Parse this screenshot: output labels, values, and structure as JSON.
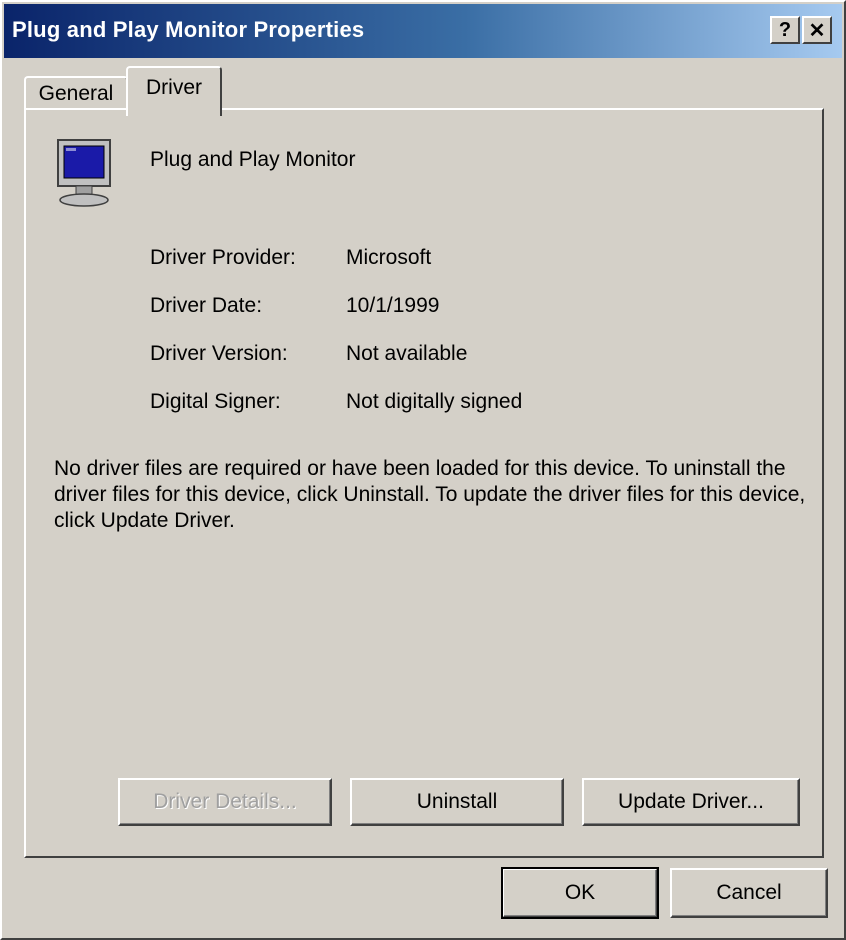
{
  "window": {
    "title": "Plug and Play Monitor Properties"
  },
  "titlebar_buttons": {
    "help_label": "?",
    "close_label": "✕"
  },
  "tabs": [
    {
      "label": "General",
      "active": false
    },
    {
      "label": "Driver",
      "active": true
    }
  ],
  "device": {
    "name": "Plug and Play Monitor",
    "icon": "monitor-icon"
  },
  "properties": [
    {
      "label": "Driver Provider:",
      "value": "Microsoft"
    },
    {
      "label": "Driver Date:",
      "value": "10/1/1999"
    },
    {
      "label": "Driver Version:",
      "value": "Not available"
    },
    {
      "label": "Digital Signer:",
      "value": "Not digitally signed"
    }
  ],
  "description": "No driver files are required or have been loaded for this device. To uninstall the driver files for this device, click Uninstall. To update the driver files for this device, click Update Driver.",
  "actions": {
    "driver_details": "Driver Details...",
    "uninstall": "Uninstall",
    "update_driver": "Update Driver..."
  },
  "footer": {
    "ok": "OK",
    "cancel": "Cancel"
  },
  "colors": {
    "face": "#d4d0c8",
    "titlebar_start": "#0a246a",
    "titlebar_end": "#a6caf0",
    "disabled_text": "#a0a0a0"
  }
}
